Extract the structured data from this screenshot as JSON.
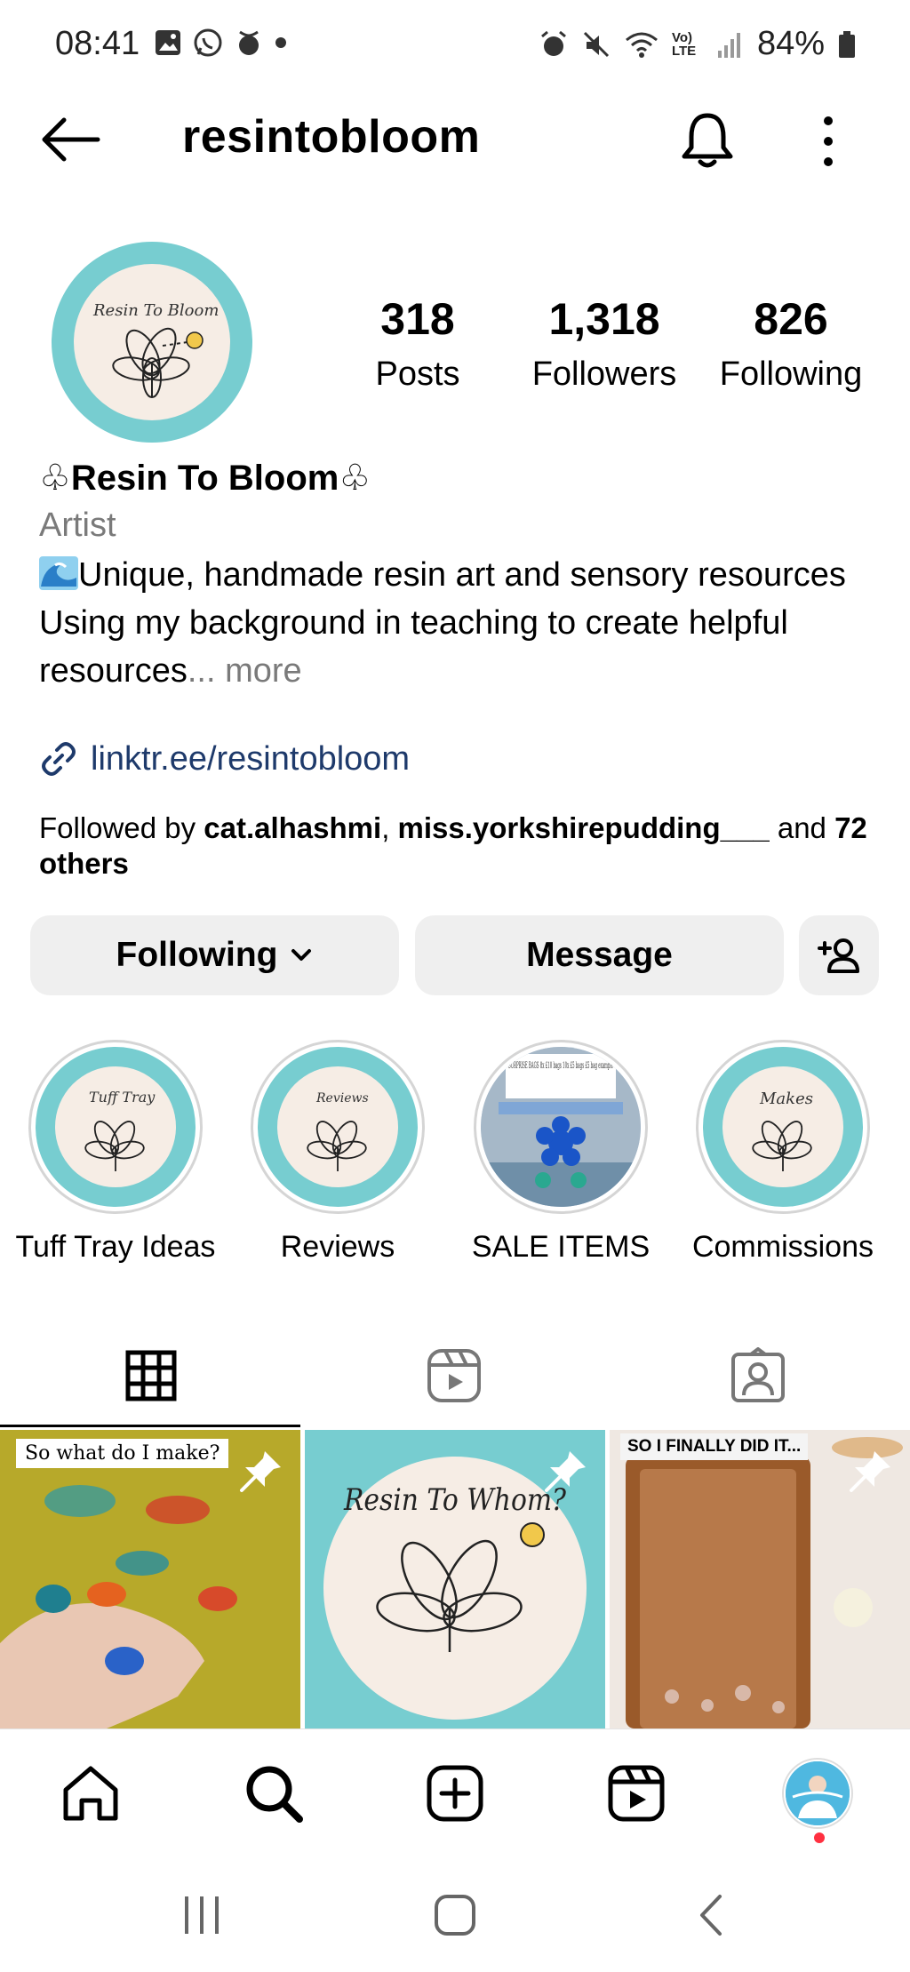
{
  "status_bar": {
    "time": "08:41",
    "battery": "84%",
    "network": "Vo) LTE"
  },
  "header": {
    "username": "resintobloom"
  },
  "profile": {
    "avatar_text": "Resin To Bloom",
    "stats": [
      {
        "value": "318",
        "label": "Posts"
      },
      {
        "value": "1,318",
        "label": "Followers"
      },
      {
        "value": "826",
        "label": "Following"
      }
    ],
    "display_name": "♧Resin To Bloom♧",
    "category": "Artist",
    "bio_line1": "Unique, handmade resin art and sensory resources",
    "bio_line2": "Using my background in teaching to create helpful resources",
    "bio_more": "... more",
    "link": "linktr.ee/resintobloom",
    "followed_by_prefix": "Followed by ",
    "followed_by_user1": "cat.alhashmi",
    "followed_by_sep": ", ",
    "followed_by_user2": "miss.yorkshirepudding___",
    "followed_by_and": " and ",
    "followed_by_rest": "72 others"
  },
  "actions": {
    "following_label": "Following",
    "message_label": "Message"
  },
  "highlights": [
    {
      "label": "Tuff Tray Ideas",
      "image_text": "Tuff Tray"
    },
    {
      "label": "Reviews",
      "image_text": "Reviews"
    },
    {
      "label": "SALE ITEMS",
      "image_text": "SURPRISE BAGS 8x £10 bags 10x £5 bags £5 bag example"
    },
    {
      "label": "Commissions",
      "image_text": "Makes"
    }
  ],
  "posts": [
    {
      "caption": "So what do I make?",
      "pinned": true
    },
    {
      "caption": "Resin To Whom?",
      "pinned": true
    },
    {
      "caption": "SO I FINALLY DID IT...",
      "pinned": true
    }
  ],
  "colors": {
    "accent_teal": "#77cdd0",
    "link_blue": "#1e3a6b",
    "button_gray": "#efefef",
    "notification_red": "#ff3040"
  }
}
